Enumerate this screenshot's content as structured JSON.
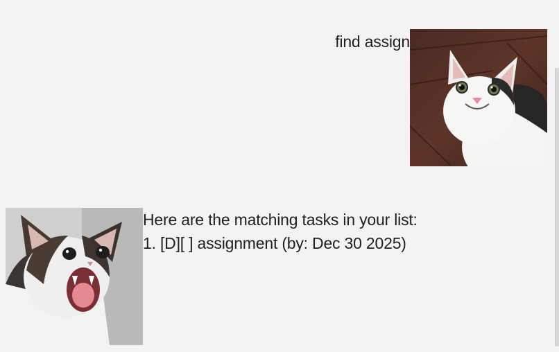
{
  "dialog": {
    "user_message": {
      "text": "find assign",
      "avatar_icon": "user-cat-avatar-icon"
    },
    "bot_message": {
      "lines": [
        "Here are the matching tasks in your list:",
        "1. [D][ ] assignment (by: Dec 30 2025)"
      ],
      "avatar_icon": "bot-cat-avatar-icon"
    }
  },
  "colors": {
    "background": "#f3f3f3",
    "text": "#202020"
  }
}
